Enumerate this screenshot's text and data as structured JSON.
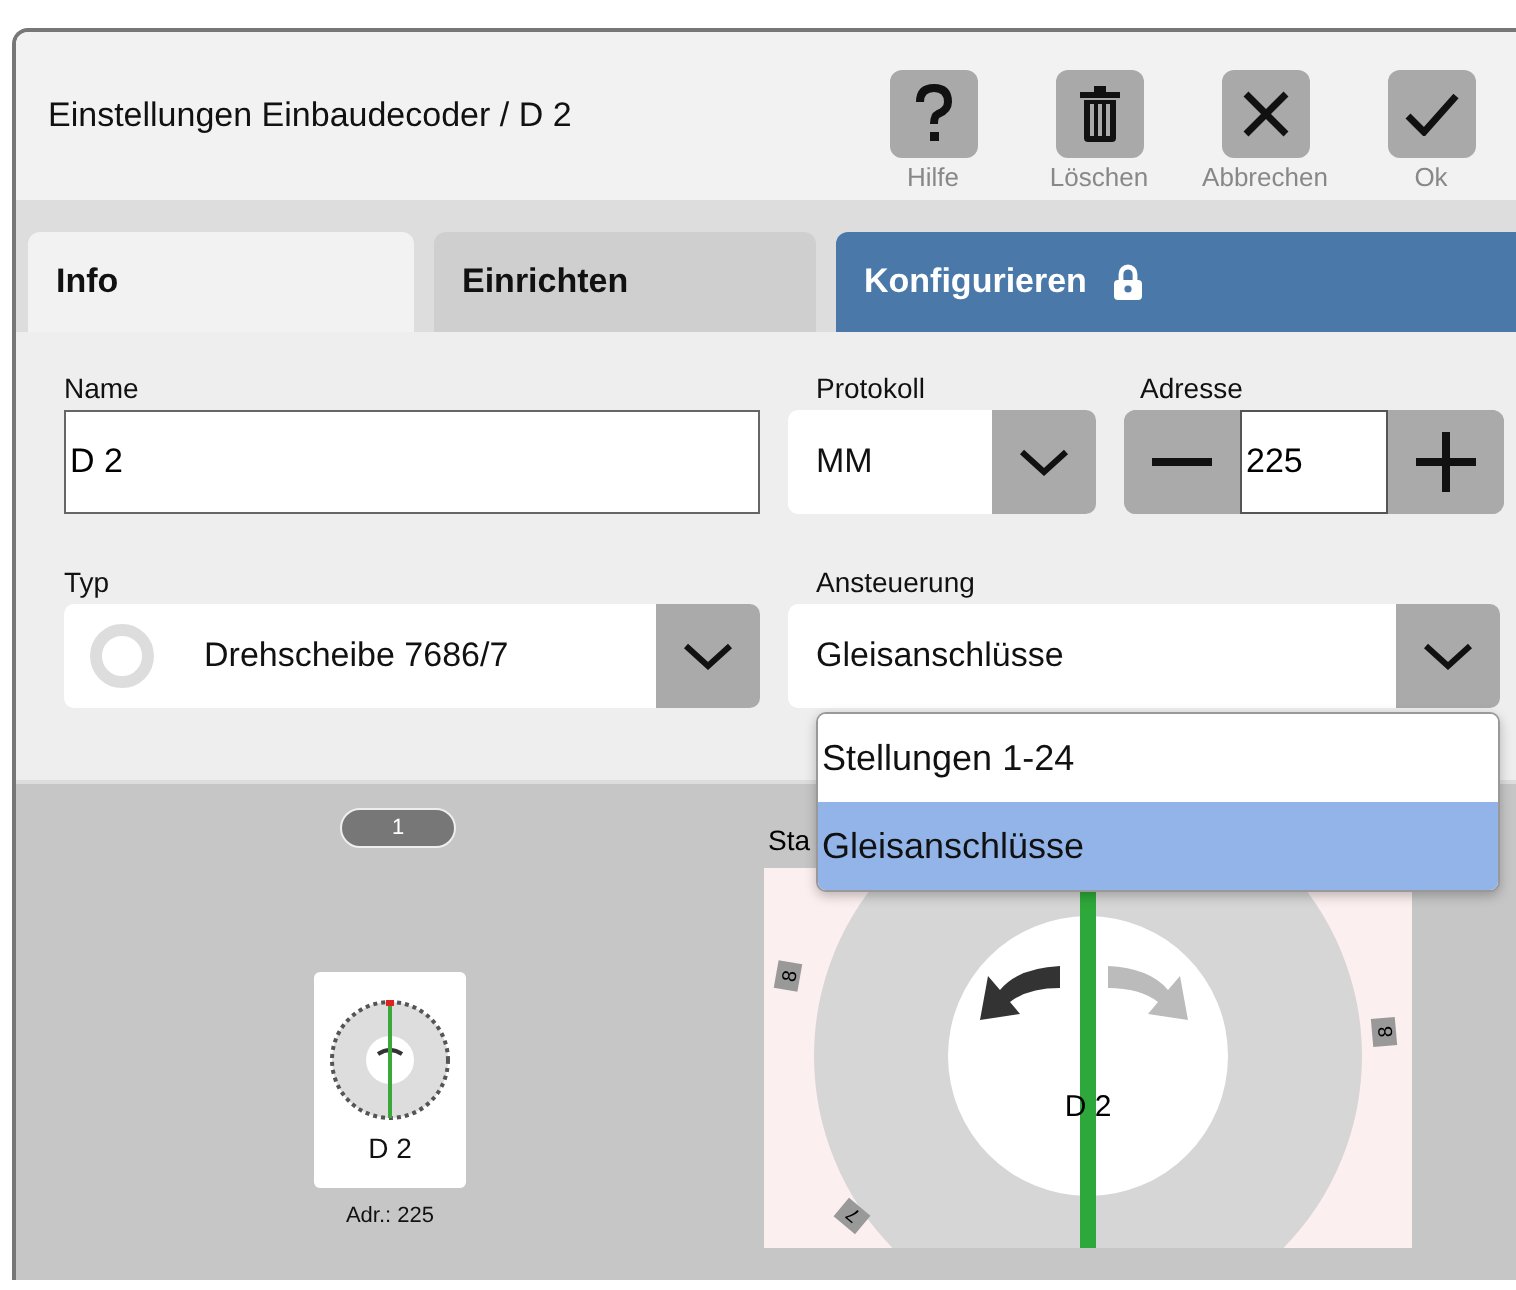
{
  "window": {
    "title": "Einstellungen Einbaudecoder / D 2"
  },
  "toolbar": [
    {
      "kind": "help",
      "label": "Hilfe"
    },
    {
      "kind": "delete",
      "label": "Löschen"
    },
    {
      "kind": "cancel",
      "label": "Abbrechen"
    },
    {
      "kind": "ok",
      "label": "Ok"
    }
  ],
  "tabs": [
    {
      "label": "Info",
      "selected": true,
      "locked": false
    },
    {
      "label": "Einrichten",
      "selected": false,
      "locked": false
    },
    {
      "label": "Konfigurieren",
      "selected": false,
      "locked": true
    }
  ],
  "form": {
    "name": {
      "label": "Name",
      "value": "D 2"
    },
    "protocol": {
      "label": "Protokoll",
      "value": "MM"
    },
    "address": {
      "label": "Adresse",
      "value": "225"
    },
    "type": {
      "label": "Typ",
      "value": "Drehscheibe 7686/7"
    },
    "control": {
      "label": "Ansteuerung",
      "value": "Gleisanschlüsse",
      "expanded": true,
      "options": [
        {
          "label": "Stellungen 1-24",
          "selected": false
        },
        {
          "label": "Gleisanschlüsse",
          "selected": true
        }
      ]
    }
  },
  "preview": {
    "page_badge": "1",
    "decoder_card": {
      "name": "D 2",
      "address": "Adr.: 225"
    },
    "diagram": {
      "caption": "Sta",
      "center_label": "D 2",
      "track_labels": [
        "8",
        "8",
        "7"
      ]
    }
  }
}
